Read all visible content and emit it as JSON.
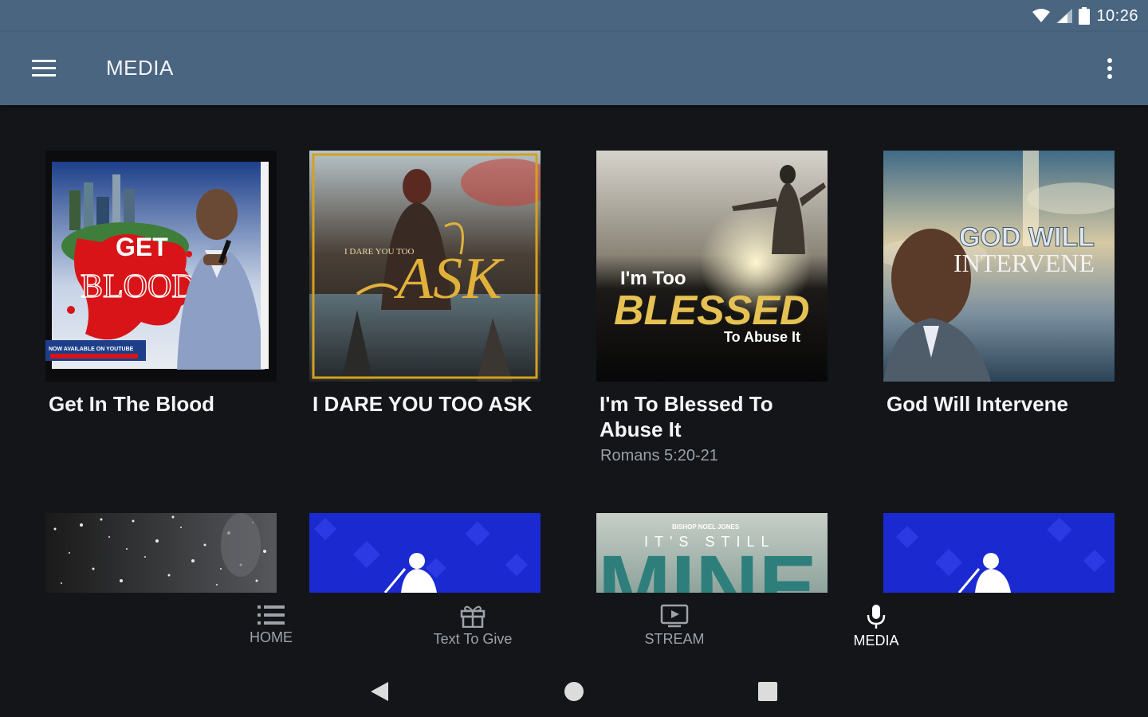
{
  "status_bar": {
    "time": "10:26"
  },
  "app_bar": {
    "title": "MEDIA"
  },
  "media_items": [
    {
      "title": "Get In The Blood",
      "subtitle": "",
      "art_lines": [
        "GET",
        "BLOOD",
        "NOW AVAILABLE ON YOUTUBE"
      ]
    },
    {
      "title": "I DARE YOU TOO ASK",
      "subtitle": "",
      "art_lines": [
        "I DARE YOU TOO",
        "ASK"
      ]
    },
    {
      "title": "I'm To Blessed To Abuse It",
      "subtitle": "Romans 5:20-21",
      "art_lines": [
        "I'm Too",
        "BLESSED",
        "To Abuse It"
      ]
    },
    {
      "title": "God Will Intervene",
      "subtitle": "",
      "art_lines": [
        "GOD WILL",
        "INTERVENE"
      ]
    }
  ],
  "second_row_art": {
    "still_mine_top": "BISHOP NOEL JONES",
    "still_mine_line": "IT'S STILL",
    "still_mine_big": "MINE"
  },
  "bottom_nav": [
    {
      "label": "HOME",
      "icon": "list-icon"
    },
    {
      "label": "Text To Give",
      "icon": "gift-icon"
    },
    {
      "label": "STREAM",
      "icon": "tv-play-icon"
    },
    {
      "label": "MEDIA",
      "icon": "microphone-icon",
      "active": true
    }
  ],
  "colors": {
    "app_bar": "#4a6580",
    "background": "#131519",
    "inactive_nav": "#9da3a9",
    "active_nav": "#ffffff"
  }
}
